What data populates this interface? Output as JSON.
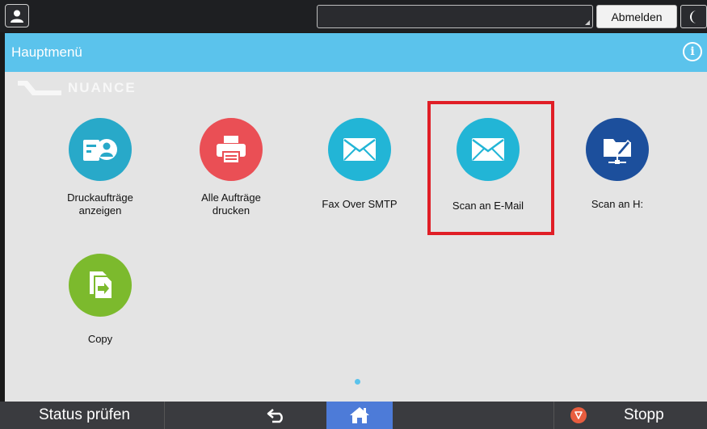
{
  "topbar": {
    "logout_label": "Abmelden",
    "input_value": ""
  },
  "header": {
    "title": "Hauptmenü"
  },
  "logo": {
    "text": "NUANCE"
  },
  "tiles": [
    {
      "label": "Druckaufträge\nanzeigen",
      "icon": "print-jobs-icon",
      "color": "#28a9c9"
    },
    {
      "label": "Alle Aufträge\ndrucken",
      "icon": "printer-icon",
      "color": "#ea4f55"
    },
    {
      "label": "Fax Over SMTP",
      "icon": "envelope-icon",
      "color": "#22b5d6"
    },
    {
      "label": "Scan an E-Mail",
      "icon": "envelope-icon",
      "color": "#22b5d6"
    },
    {
      "label": "Scan an H:",
      "icon": "network-folder-icon",
      "color": "#1c4f9c"
    },
    {
      "label": "Copy",
      "icon": "copy-icon",
      "color": "#7cba2d"
    }
  ],
  "bottombar": {
    "status_label": "Status prüfen",
    "stop_label": "Stopp"
  },
  "colors": {
    "accent": "#5bc3ec",
    "highlight": "#e01e26",
    "home": "#4d7bd8"
  }
}
